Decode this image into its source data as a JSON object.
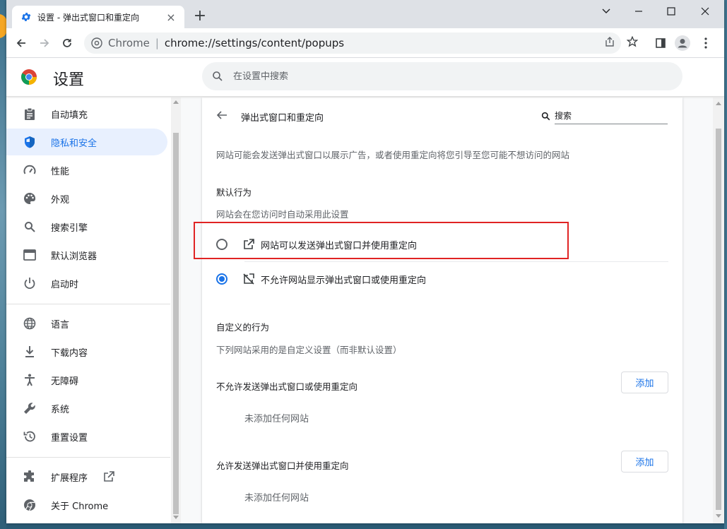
{
  "browser": {
    "tab_title": "设置 - 弹出式窗口和重定向",
    "site_name": "Chrome",
    "url": "chrome://settings/content/popups"
  },
  "settings": {
    "title": "设置",
    "search_placeholder": "在设置中搜索"
  },
  "sidebar": {
    "items": [
      {
        "label": "自动填充",
        "icon": "clipboard-icon"
      },
      {
        "label": "隐私和安全",
        "icon": "shield-icon",
        "active": true
      },
      {
        "label": "性能",
        "icon": "speedometer-icon"
      },
      {
        "label": "外观",
        "icon": "palette-icon"
      },
      {
        "label": "搜索引擎",
        "icon": "search-icon"
      },
      {
        "label": "默认浏览器",
        "icon": "browser-window-icon"
      },
      {
        "label": "启动时",
        "icon": "power-icon"
      },
      {
        "label": "语言",
        "icon": "globe-icon"
      },
      {
        "label": "下载内容",
        "icon": "download-icon"
      },
      {
        "label": "无障碍",
        "icon": "accessibility-icon"
      },
      {
        "label": "系统",
        "icon": "wrench-icon"
      },
      {
        "label": "重置设置",
        "icon": "history-icon"
      },
      {
        "label": "扩展程序",
        "icon": "puzzle-icon"
      },
      {
        "label": "关于 Chrome",
        "icon": "chrome-icon"
      }
    ]
  },
  "page": {
    "title": "弹出式窗口和重定向",
    "search_placeholder": "搜索",
    "description": "网站可能会发送弹出式窗口以展示广告，或者使用重定向将您引导至您可能不想访问的网站",
    "default_heading": "默认行为",
    "default_sub": "网站会在您访问时自动采用此设置",
    "options": [
      {
        "label": "网站可以发送弹出式窗口并使用重定向",
        "selected": false,
        "icon": "open-in-new-icon"
      },
      {
        "label": "不允许网站显示弹出式窗口或使用重定向",
        "selected": true,
        "icon": "popup-blocked-icon"
      }
    ],
    "custom_heading": "自定义的行为",
    "custom_sub": "下列网站采用的是自定义设置（而非默认设置）",
    "block_list": {
      "title": "不允许发送弹出式窗口或使用重定向",
      "add_label": "添加",
      "empty": "未添加任何网站"
    },
    "allow_list": {
      "title": "允许发送弹出式窗口并使用重定向",
      "add_label": "添加",
      "empty": "未添加任何网站"
    }
  },
  "colors": {
    "accent": "#1a73e8",
    "highlight": "#e02424"
  }
}
